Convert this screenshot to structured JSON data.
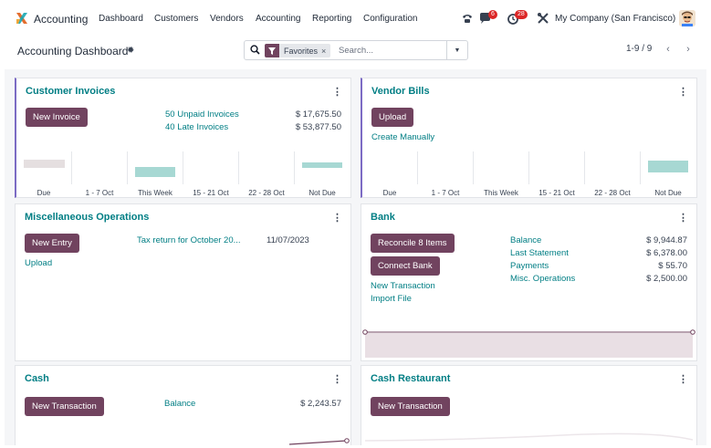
{
  "app": {
    "name": "Accounting"
  },
  "nav": {
    "menu": [
      "Dashboard",
      "Customers",
      "Vendors",
      "Accounting",
      "Reporting",
      "Configuration"
    ],
    "messages_count": "6",
    "activities_count": "28",
    "company": "My Company (San Francisco)"
  },
  "controlbar": {
    "title": "Accounting Dashboard",
    "facet": "Favorites",
    "search_placeholder": "Search...",
    "pager": "1-9 / 9"
  },
  "cards": {
    "customer_invoices": {
      "title": "Customer Invoices",
      "button": "New Invoice",
      "rows": [
        {
          "label": "50 Unpaid Invoices",
          "value": "$ 17,675.50"
        },
        {
          "label": "40 Late Invoices",
          "value": "$ 53,877.50"
        }
      ]
    },
    "vendor_bills": {
      "title": "Vendor Bills",
      "button": "Upload",
      "link": "Create Manually"
    },
    "misc": {
      "title": "Miscellaneous Operations",
      "button": "New Entry",
      "link": "Upload",
      "item_label": "Tax return for October 20...",
      "item_date": "11/07/2023"
    },
    "bank": {
      "title": "Bank",
      "button1": "Reconcile 8 Items",
      "button2": "Connect Bank",
      "link1": "New Transaction",
      "link2": "Import File",
      "rows": [
        {
          "label": "Balance",
          "value": "$ 9,944.87"
        },
        {
          "label": "Last Statement",
          "value": "$ 6,378.00"
        },
        {
          "label": "Payments",
          "value": "$ 55.70"
        },
        {
          "label": "Misc. Operations",
          "value": "$ 2,500.00"
        }
      ]
    },
    "cash": {
      "title": "Cash",
      "button": "New Transaction",
      "balance_label": "Balance",
      "balance_value": "$ 2,243.57"
    },
    "cash_restaurant": {
      "title": "Cash Restaurant",
      "button": "New Transaction"
    }
  },
  "aging_labels": [
    "Due",
    "1 - 7 Oct",
    "This Week",
    "15 - 21 Oct",
    "22 - 28 Oct",
    "Not Due"
  ],
  "colors": {
    "brand": "#71435f",
    "link": "#017e84",
    "bar_paid": "#a7d8d3",
    "bar_due": "#e5dfe0"
  }
}
